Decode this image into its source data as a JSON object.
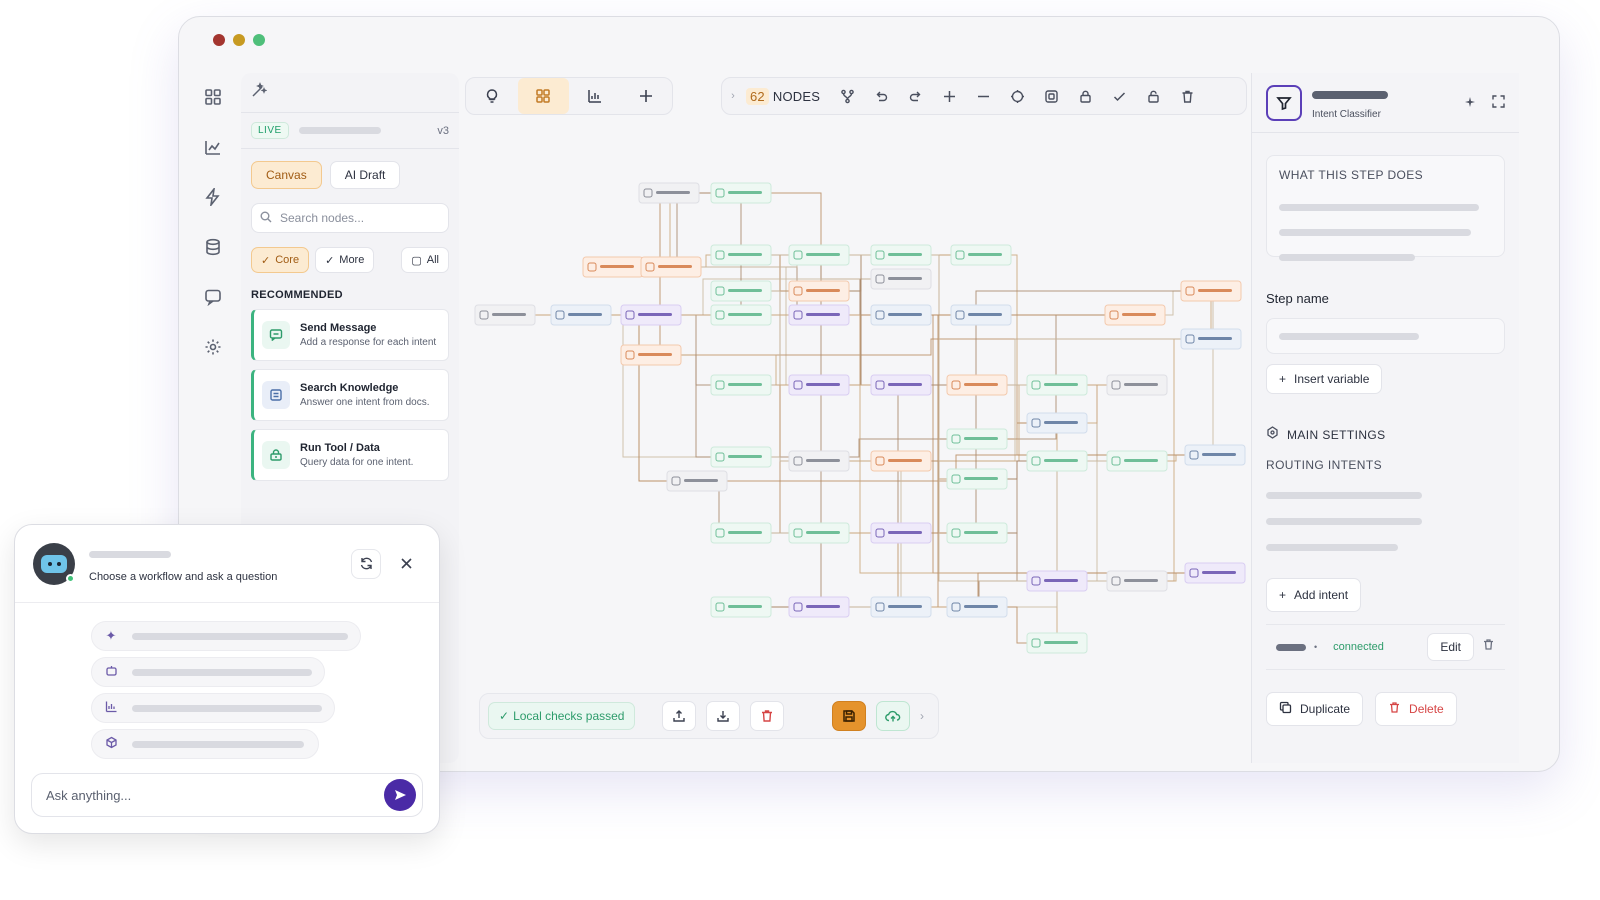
{
  "left_panel": {
    "status_badge": "LIVE",
    "version": "v3",
    "modes": [
      "Canvas",
      "AI Draft"
    ],
    "search_placeholder": "Search nodes...",
    "filters": [
      "Core",
      "More",
      "All"
    ],
    "section_title": "RECOMMENDED",
    "recommended": [
      {
        "name": "Send Message",
        "desc": "Add a response for each intent",
        "icon": "message-icon"
      },
      {
        "name": "Search Knowledge",
        "desc": "Answer one intent from docs.",
        "icon": "document-icon"
      },
      {
        "name": "Run Tool / Data",
        "desc": "Query data for one intent.",
        "icon": "database-icon"
      }
    ]
  },
  "toolbar": {
    "node_count": "62",
    "nodes_label": "NODES"
  },
  "bottom_bar": {
    "checks_label": "Local checks passed"
  },
  "right_panel": {
    "subtitle": "Intent Classifier",
    "what_label": "WHAT THIS STEP DOES",
    "step_name_label": "Step name",
    "insert_variable": "Insert variable",
    "main_settings": "MAIN SETTINGS",
    "routing_intents": "ROUTING INTENTS",
    "add_intent": "Add intent",
    "connected": "connected",
    "edit": "Edit",
    "duplicate": "Duplicate",
    "delete": "Delete"
  },
  "chat": {
    "subtitle": "Choose a workflow and ask a question",
    "input_placeholder": "Ask anything..."
  },
  "colors": {
    "accent_orange": "#e5932c",
    "accent_purple": "#4a2aa6",
    "success_green": "#2e9c6b",
    "danger_red": "#d64545"
  }
}
